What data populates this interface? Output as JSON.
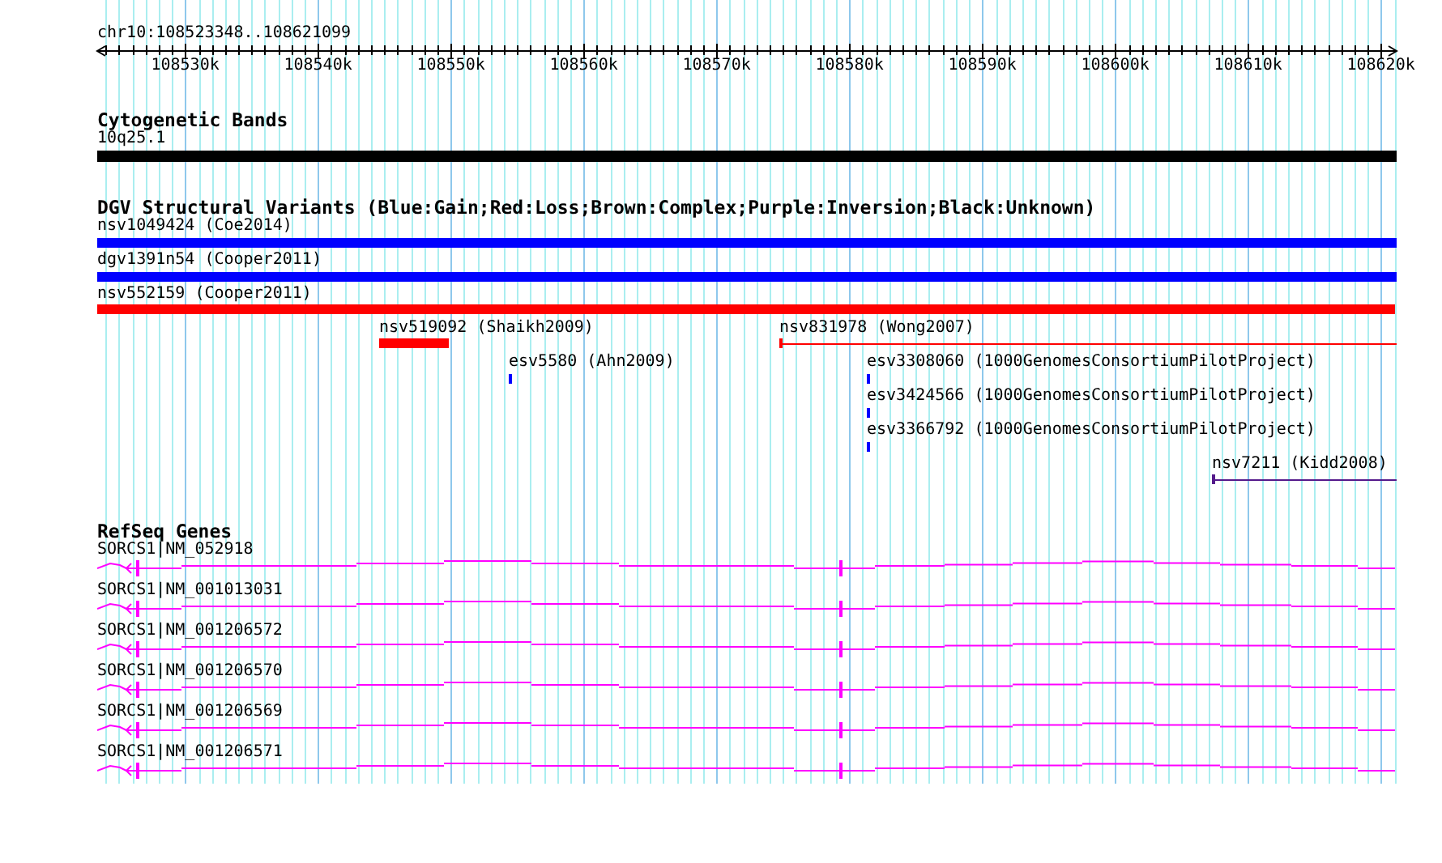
{
  "ruler": {
    "range": "chr10:108523348..108621099",
    "ticks": [
      "108530k",
      "108540k",
      "108550k",
      "108560k",
      "108570k",
      "108580k",
      "108590k",
      "108600k",
      "108610k",
      "108620k"
    ]
  },
  "tracks": [
    {
      "title": "Cytogenetic Bands",
      "kind": "cytoband",
      "features": [
        {
          "label": "10q25.1"
        }
      ]
    },
    {
      "title": "DGV Structural Variants (Blue:Gain;Red:Loss;Brown:Complex;Purple:Inversion;Black:Unknown)",
      "kind": "variants",
      "features": [
        {
          "label": "nsv1049424 (Coe2014)",
          "color": "#0000ff"
        },
        {
          "label": "dgv1391n54 (Cooper2011)",
          "color": "#0000ff"
        },
        {
          "label": "nsv552159 (Cooper2011)",
          "color": "#ff0000"
        },
        {
          "label": "nsv519092 (Shaikh2009)",
          "color": "#ff0000"
        },
        {
          "label": "nsv831978 (Wong2007)",
          "color": "#ff0000"
        },
        {
          "label": "esv5580 (Ahn2009)",
          "color": "#0000ff"
        },
        {
          "label": "esv3308060 (1000GenomesConsortiumPilotProject)",
          "color": "#0000ff"
        },
        {
          "label": "esv3424566 (1000GenomesConsortiumPilotProject)",
          "color": "#0000ff"
        },
        {
          "label": "esv3366792 (1000GenomesConsortiumPilotProject)",
          "color": "#0000ff"
        },
        {
          "label": "nsv7211 (Kidd2008)",
          "color": "#551a8b"
        }
      ]
    },
    {
      "title": "RefSeq Genes",
      "kind": "genes",
      "features": [
        {
          "label": "SORCS1|NM_052918"
        },
        {
          "label": "SORCS1|NM_001013031"
        },
        {
          "label": "SORCS1|NM_001206572"
        },
        {
          "label": "SORCS1|NM_001206570"
        },
        {
          "label": "SORCS1|NM_001206569"
        },
        {
          "label": "SORCS1|NM_001206571"
        }
      ]
    }
  ]
}
